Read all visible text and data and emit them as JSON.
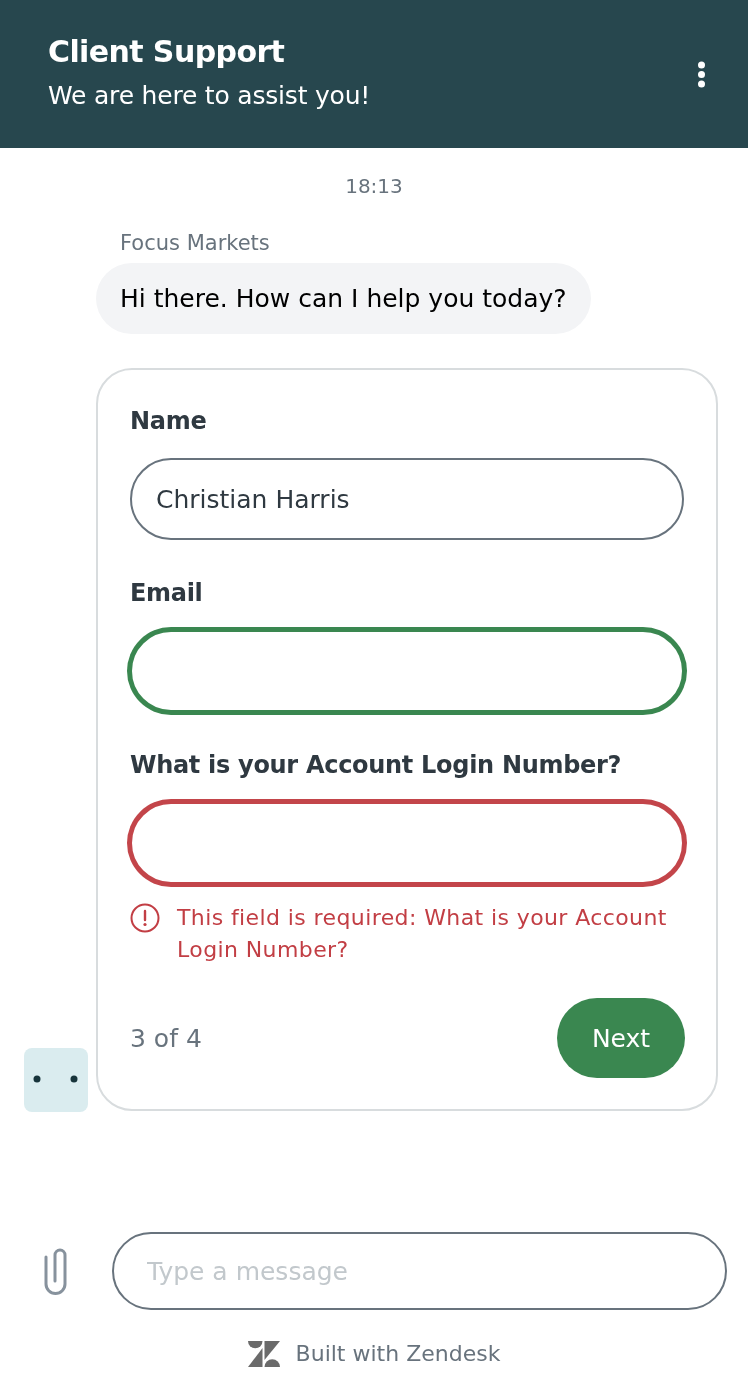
{
  "header": {
    "title": "Client Support",
    "subtitle": "We are here to assist you!"
  },
  "conversation": {
    "timestamp": "18:13",
    "sender": "Focus Markets",
    "message": "Hi there. How can I help you today?"
  },
  "form": {
    "fields": [
      {
        "label": "Name",
        "value": "Christian Harris",
        "focused": false,
        "invalid": false
      },
      {
        "label": "Email",
        "focused": true,
        "invalid": false
      },
      {
        "label": "What is your Account Login Number?",
        "focused": false,
        "invalid": true,
        "error": "This field is required: What is your Account Login Number?"
      }
    ],
    "step": "3 of 4",
    "button": "Next"
  },
  "composer": {
    "placeholder": "Type a message"
  },
  "footer": {
    "text": "Built with Zendesk"
  }
}
